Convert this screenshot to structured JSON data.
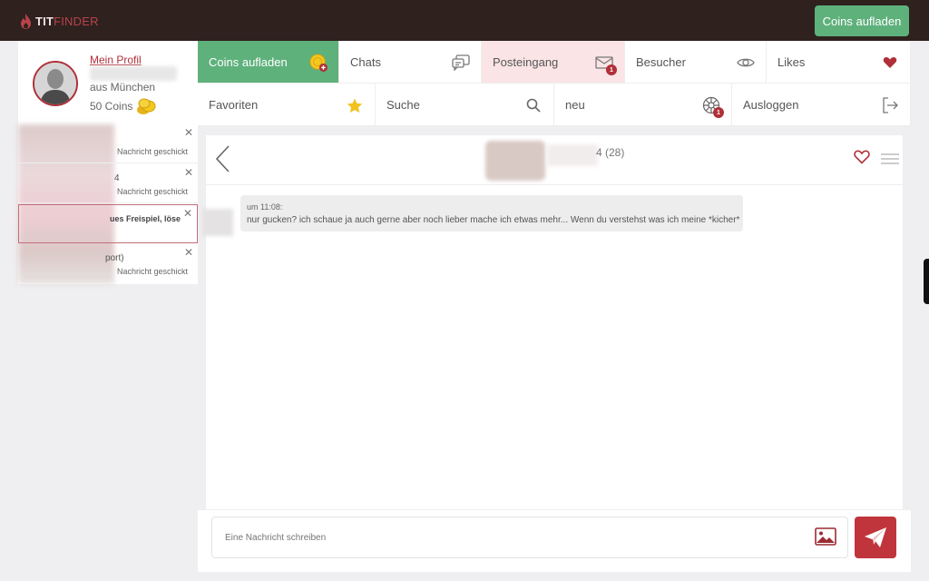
{
  "brand": {
    "part1": "TIT",
    "part2": "FINDER"
  },
  "topbar": {
    "coins_button": "Coins aufladen"
  },
  "profile": {
    "link": "Mein Profil",
    "city": "aus München",
    "coins": "50 Coins"
  },
  "conversations": [
    {
      "title": "",
      "status": "Nachricht geschickt"
    },
    {
      "title": "4",
      "status": "Nachricht geschickt"
    },
    {
      "title": "ues Freispiel, löse",
      "status": ""
    },
    {
      "title": "port)",
      "status": "Nachricht geschickt"
    }
  ],
  "nav": {
    "coins": "Coins aufladen",
    "chats": "Chats",
    "inbox": "Posteingang",
    "inbox_badge": "1",
    "visitors": "Besucher",
    "likes": "Likes",
    "favorites": "Favoriten",
    "search": "Suche",
    "new": "neu",
    "new_badge": "1",
    "logout": "Ausloggen"
  },
  "chat": {
    "partner_age": "4 (28)",
    "messages": [
      {
        "time": "um 11:08:",
        "text": "nur gucken? ich schaue ja auch gerne aber noch lieber mache ich etwas mehr... Wenn du verstehst was ich meine *kicher*"
      }
    ]
  },
  "composer": {
    "placeholder": "Eine Nachricht schreiben"
  },
  "colors": {
    "accent": "#b02f38",
    "green": "#5fb17c",
    "topbar": "#2e211e"
  }
}
